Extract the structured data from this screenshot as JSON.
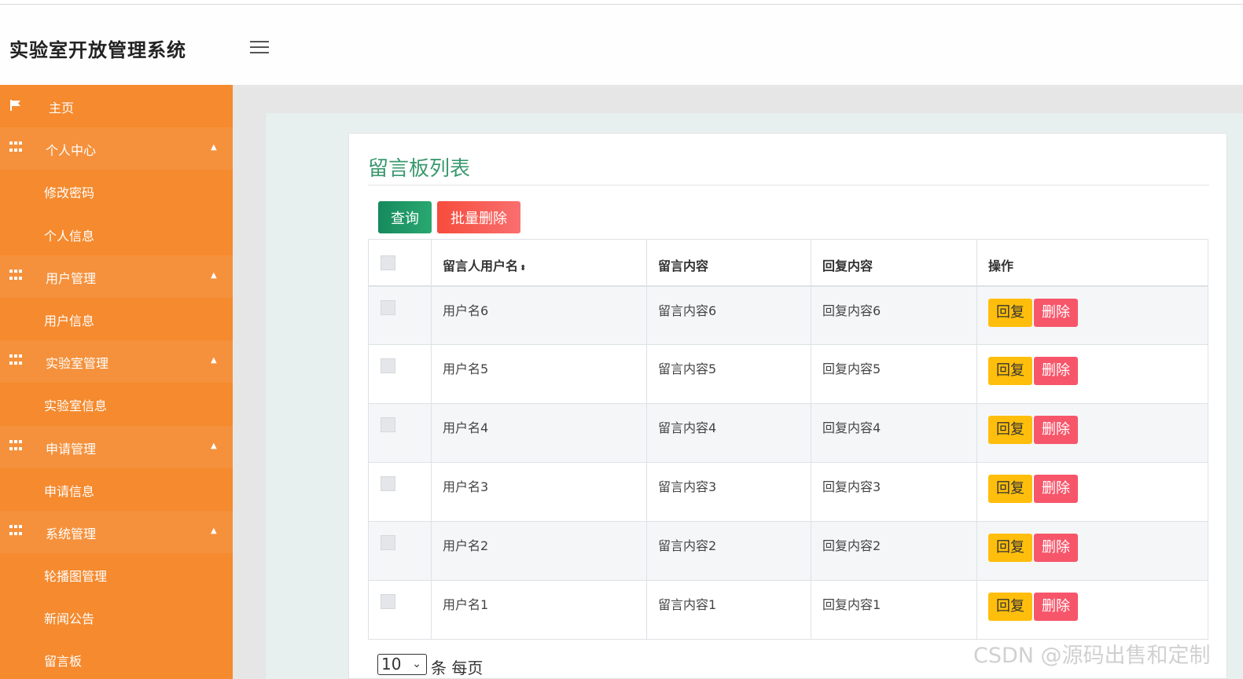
{
  "app": {
    "title": "实验室开放管理系统"
  },
  "sidebar": {
    "items": [
      {
        "label": "主页",
        "type": "home"
      },
      {
        "label": "个人中心",
        "type": "main"
      },
      {
        "label": "修改密码",
        "type": "sub"
      },
      {
        "label": "个人信息",
        "type": "sub"
      },
      {
        "label": "用户管理",
        "type": "main"
      },
      {
        "label": "用户信息",
        "type": "sub"
      },
      {
        "label": "实验室管理",
        "type": "main"
      },
      {
        "label": "实验室信息",
        "type": "sub"
      },
      {
        "label": "申请管理",
        "type": "main"
      },
      {
        "label": "申请信息",
        "type": "sub"
      },
      {
        "label": "系统管理",
        "type": "main"
      },
      {
        "label": "轮播图管理",
        "type": "sub"
      },
      {
        "label": "新闻公告",
        "type": "sub"
      },
      {
        "label": "留言板",
        "type": "sub"
      }
    ]
  },
  "panel": {
    "title": "留言板列表",
    "query_label": "查询",
    "bulk_delete_label": "批量删除"
  },
  "table": {
    "headers": {
      "user": "留言人用户名",
      "message": "留言内容",
      "reply": "回复内容",
      "actions": "操作"
    },
    "rows": [
      {
        "user": "用户名6",
        "message": "留言内容6",
        "reply": "回复内容6"
      },
      {
        "user": "用户名5",
        "message": "留言内容5",
        "reply": "回复内容5"
      },
      {
        "user": "用户名4",
        "message": "留言内容4",
        "reply": "回复内容4"
      },
      {
        "user": "用户名3",
        "message": "留言内容3",
        "reply": "回复内容3"
      },
      {
        "user": "用户名2",
        "message": "留言内容2",
        "reply": "回复内容2"
      },
      {
        "user": "用户名1",
        "message": "留言内容1",
        "reply": "回复内容1"
      }
    ],
    "reply_label": "回复",
    "delete_label": "删除"
  },
  "pager": {
    "page_size": "10",
    "per_page_text": "条 每页"
  },
  "watermark": "CSDN @源码出售和定制",
  "colors": {
    "sidebar": "#f58a2e",
    "title_green": "#3a9a6e",
    "query": "#1e9966",
    "danger": "#f7566a",
    "warning": "#ffbe0b"
  }
}
